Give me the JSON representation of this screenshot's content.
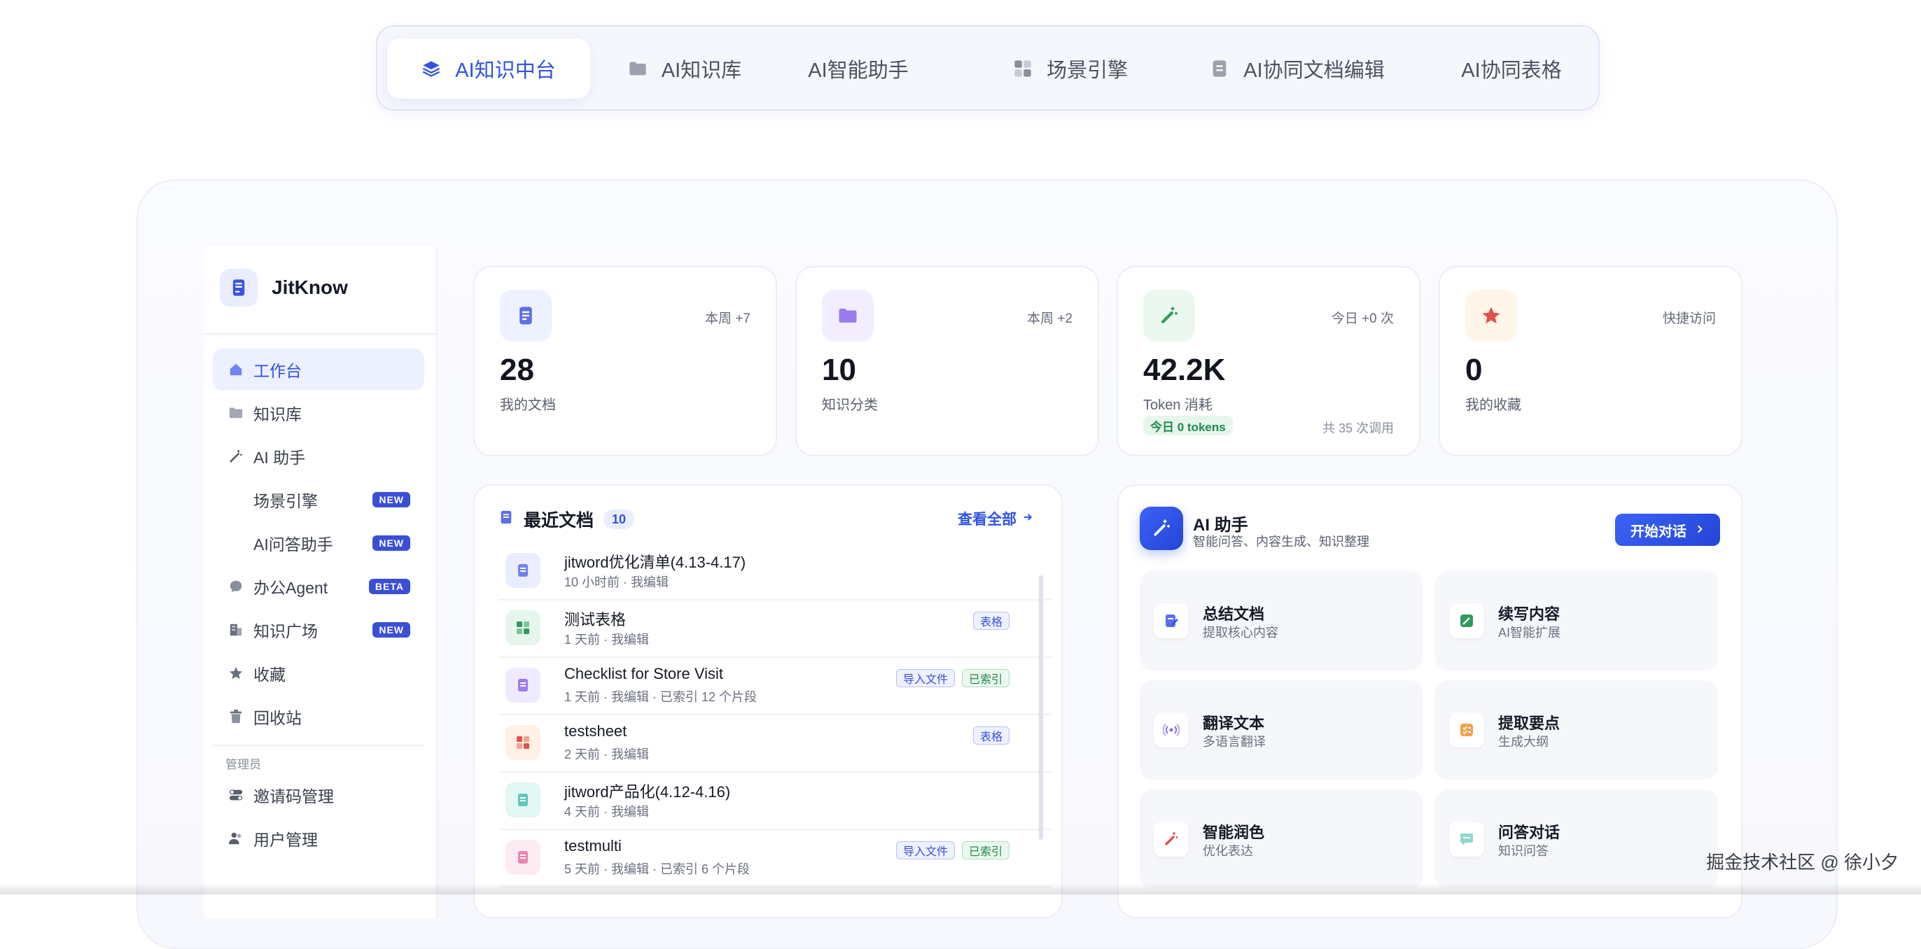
{
  "top_tabs": [
    {
      "label": "AI知识中台",
      "active": true,
      "icon": "layers-icon"
    },
    {
      "label": "AI知识库",
      "active": false,
      "icon": "folder-icon"
    },
    {
      "label": "AI智能助手",
      "active": false,
      "icon": ""
    },
    {
      "label": "场景引擎",
      "active": false,
      "icon": "grid-icon"
    },
    {
      "label": "AI协同文档编辑",
      "active": false,
      "icon": "document-icon"
    },
    {
      "label": "AI协同表格",
      "active": false,
      "icon": ""
    }
  ],
  "sidebar": {
    "brand": "JitKnow",
    "items": [
      {
        "label": "工作台",
        "icon": "home-icon",
        "active": true,
        "badge": ""
      },
      {
        "label": "知识库",
        "icon": "folder-icon",
        "active": false,
        "badge": ""
      },
      {
        "label": "AI 助手",
        "icon": "magic-wand-icon",
        "active": false,
        "badge": ""
      },
      {
        "label": "场景引擎",
        "icon": "",
        "active": false,
        "badge": "NEW"
      },
      {
        "label": "AI问答助手",
        "icon": "",
        "active": false,
        "badge": "NEW"
      },
      {
        "label": "办公Agent",
        "icon": "chat-icon",
        "active": false,
        "badge": "BETA"
      },
      {
        "label": "知识广场",
        "icon": "building-icon",
        "active": false,
        "badge": "NEW"
      },
      {
        "label": "收藏",
        "icon": "star-icon",
        "active": false,
        "badge": ""
      },
      {
        "label": "回收站",
        "icon": "trash-icon",
        "active": false,
        "badge": ""
      }
    ],
    "admin_section": "管理员",
    "admin_items": [
      {
        "label": "邀请码管理",
        "icon": "toggle-icon"
      },
      {
        "label": "用户管理",
        "icon": "users-icon"
      }
    ]
  },
  "stats": [
    {
      "value": "28",
      "label": "我的文档",
      "tag": "本周 +7",
      "icon": "document-icon",
      "color": "#4a63e6",
      "bg": "#eef1ff"
    },
    {
      "value": "10",
      "label": "知识分类",
      "tag": "本周 +2",
      "icon": "folder-icon",
      "color": "#8b6be8",
      "bg": "#f2eeff"
    },
    {
      "value": "42.2K",
      "label": "Token 消耗",
      "tag": "今日 +0 次",
      "icon": "magic-wand-icon",
      "color": "#2f9b5a",
      "bg": "#eaf8ef",
      "pill": "今日 0 tokens",
      "foot": "共 35 次调用"
    },
    {
      "value": "0",
      "label": "我的收藏",
      "tag": "快捷访问",
      "icon": "star-icon",
      "color": "#e0524a",
      "bg": "#fff6e9"
    }
  ],
  "recent_docs": {
    "title": "最近文档",
    "count": "10",
    "view_all": "查看全部",
    "rows": [
      {
        "title": "jitword优化清单(4.13-4.17)",
        "meta": "10 小时前 · 我编辑",
        "tags": [],
        "icon_color": "#5b6fe6",
        "icon_bg": "#e9edff"
      },
      {
        "title": "测试表格",
        "meta": "1 天前 · 我编辑",
        "tags": [
          {
            "text": "表格",
            "kind": "blue"
          }
        ],
        "icon_color": "#2f9b5a",
        "icon_bg": "#e6f6ec"
      },
      {
        "title": "Checklist for Store Visit",
        "meta": "1 天前 · 我编辑 · 已索引 12 个片段",
        "tags": [
          {
            "text": "导入文件",
            "kind": "blue"
          },
          {
            "text": "已索引",
            "kind": "green"
          }
        ],
        "icon_color": "#8b6be8",
        "icon_bg": "#efeaff"
      },
      {
        "title": "testsheet",
        "meta": "2 天前 · 我编辑",
        "tags": [
          {
            "text": "表格",
            "kind": "blue"
          }
        ],
        "icon_color": "#e0524a",
        "icon_bg": "#fff1e6"
      },
      {
        "title": "jitword产品化(4.12-4.16)",
        "meta": "4 天前 · 我编辑",
        "tags": [],
        "icon_color": "#33b3a4",
        "icon_bg": "#e3f7f4"
      },
      {
        "title": "testmulti",
        "meta": "5 天前 · 我编辑 · 已索引 6 个片段",
        "tags": [
          {
            "text": "导入文件",
            "kind": "blue"
          },
          {
            "text": "已索引",
            "kind": "green"
          }
        ],
        "icon_color": "#e05a8f",
        "icon_bg": "#fdebf2"
      }
    ]
  },
  "ai_assistant": {
    "title": "AI 助手",
    "subtitle": "智能问答、内容生成、知识整理",
    "start_button": "开始对话",
    "features": [
      {
        "title": "总结文档",
        "sub": "提取核心内容",
        "icon": "summary-icon",
        "color": "#4a63e6"
      },
      {
        "title": "续写内容",
        "sub": "AI智能扩展",
        "icon": "pencil-icon",
        "color": "#2f9b5a"
      },
      {
        "title": "翻译文本",
        "sub": "多语言翻译",
        "icon": "broadcast-icon",
        "color": "#8b6be8"
      },
      {
        "title": "提取要点",
        "sub": "生成大纲",
        "icon": "checklist-icon",
        "color": "#f0a24a"
      },
      {
        "title": "智能润色",
        "sub": "优化表达",
        "icon": "magic-wand-icon",
        "color": "#e0524a"
      },
      {
        "title": "问答对话",
        "sub": "知识问答",
        "icon": "chat-icon",
        "color": "#33b3a4"
      }
    ]
  },
  "watermark": "掘金技术社区 @ 徐小夕"
}
